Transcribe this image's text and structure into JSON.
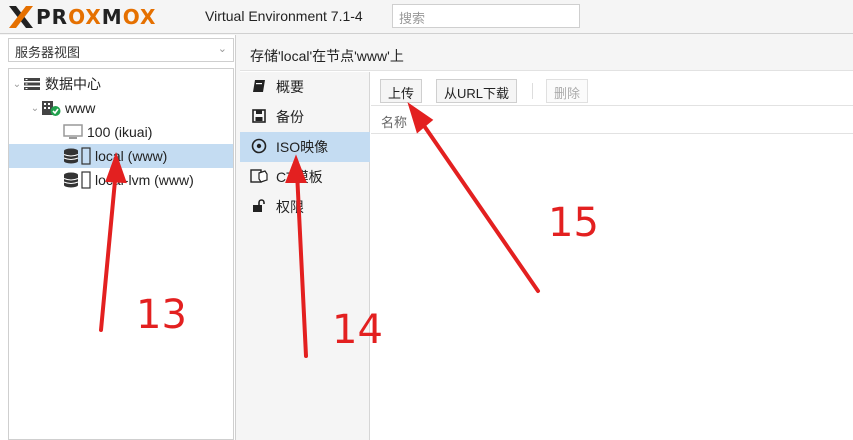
{
  "header": {
    "logo_pre": "PR",
    "logo_ox1": "OX",
    "logo_mid": "M",
    "logo_ox2": "OX",
    "version": "Virtual Environment 7.1-4",
    "search_placeholder": "搜索"
  },
  "sidebar": {
    "view": "服务器视图",
    "tree": [
      {
        "label": "数据中心",
        "icon": "datacenter-icon"
      },
      {
        "label": "www",
        "icon": "node-icon"
      },
      {
        "label": "100 (ikuai)",
        "icon": "monitor-icon"
      },
      {
        "label": "local (www)",
        "icon": "storage-icon",
        "selected": true
      },
      {
        "label": "local-lvm (www)",
        "icon": "storage-icon"
      }
    ]
  },
  "main": {
    "title": "存储'local'在节点'www'上",
    "nav": [
      {
        "label": "概要",
        "icon": "book-icon"
      },
      {
        "label": "备份",
        "icon": "floppy-icon"
      },
      {
        "label": "ISO映像",
        "icon": "disc-icon",
        "active": true
      },
      {
        "label": "CT模板",
        "icon": "template-icon"
      },
      {
        "label": "权限",
        "icon": "unlock-icon"
      }
    ],
    "toolbar": {
      "upload": "上传",
      "download_url": "从URL下载",
      "delete": "删除"
    },
    "column_name": "名称"
  },
  "annotations": {
    "n13": "13",
    "n14": "14",
    "n15": "15",
    "color": "#e32020"
  }
}
